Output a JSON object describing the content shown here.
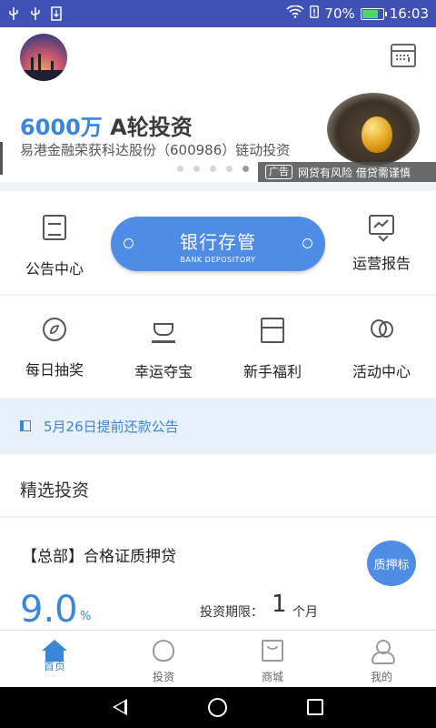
{
  "status_bar": {
    "battery": "70%",
    "time": "16:03",
    "icons": [
      "usb-icon",
      "usb-icon",
      "download-icon",
      "wifi-icon",
      "sim-alert-icon",
      "battery-icon"
    ]
  },
  "header": {
    "avatar_icon": "user-avatar",
    "calendar_icon": "calendar-icon"
  },
  "banner": {
    "amount": "6000万",
    "title_rest": " A轮投资",
    "subtitle": "易港金融荣获科达股份（600986）链动投资",
    "ad_tag": "广告",
    "ad_warning": "网贷有风险  借贷需谨慎",
    "dot_count": 5,
    "active_dot": 4
  },
  "quick_menu": {
    "notice_center": "公告中心",
    "bank_deposit": "银行存管",
    "bank_deposit_en": "BANK DEPOSITORY",
    "ops_report": "运营报告"
  },
  "features": [
    {
      "label": "每日抽奖",
      "icon": "lottery-icon"
    },
    {
      "label": "幸运夺宝",
      "icon": "ingot-icon"
    },
    {
      "label": "新手福利",
      "icon": "gift-icon"
    },
    {
      "label": "活动中心",
      "icon": "balloons-icon"
    }
  ],
  "notice": {
    "text": "5月26日提前还款公告",
    "icon": "speaker-icon"
  },
  "selected": {
    "title": "精选投资"
  },
  "product": {
    "name": "【总部】合格证质押贷",
    "badge": "质押标",
    "rate": "9.0",
    "rate_unit": "%",
    "term_label": "投资期限：",
    "term_value": "1",
    "term_unit": "个月"
  },
  "tabs": [
    {
      "label": "首页",
      "icon": "home-icon",
      "active": true
    },
    {
      "label": "投资",
      "icon": "money-bag-icon",
      "active": false
    },
    {
      "label": "商城",
      "icon": "shop-icon",
      "active": false
    },
    {
      "label": "我的",
      "icon": "user-icon",
      "active": false
    }
  ],
  "colors": {
    "accent": "#3b86d6",
    "button": "#4e8ce6",
    "status_bar": "#3f51b5",
    "notice_bg": "#e8f0fb"
  }
}
